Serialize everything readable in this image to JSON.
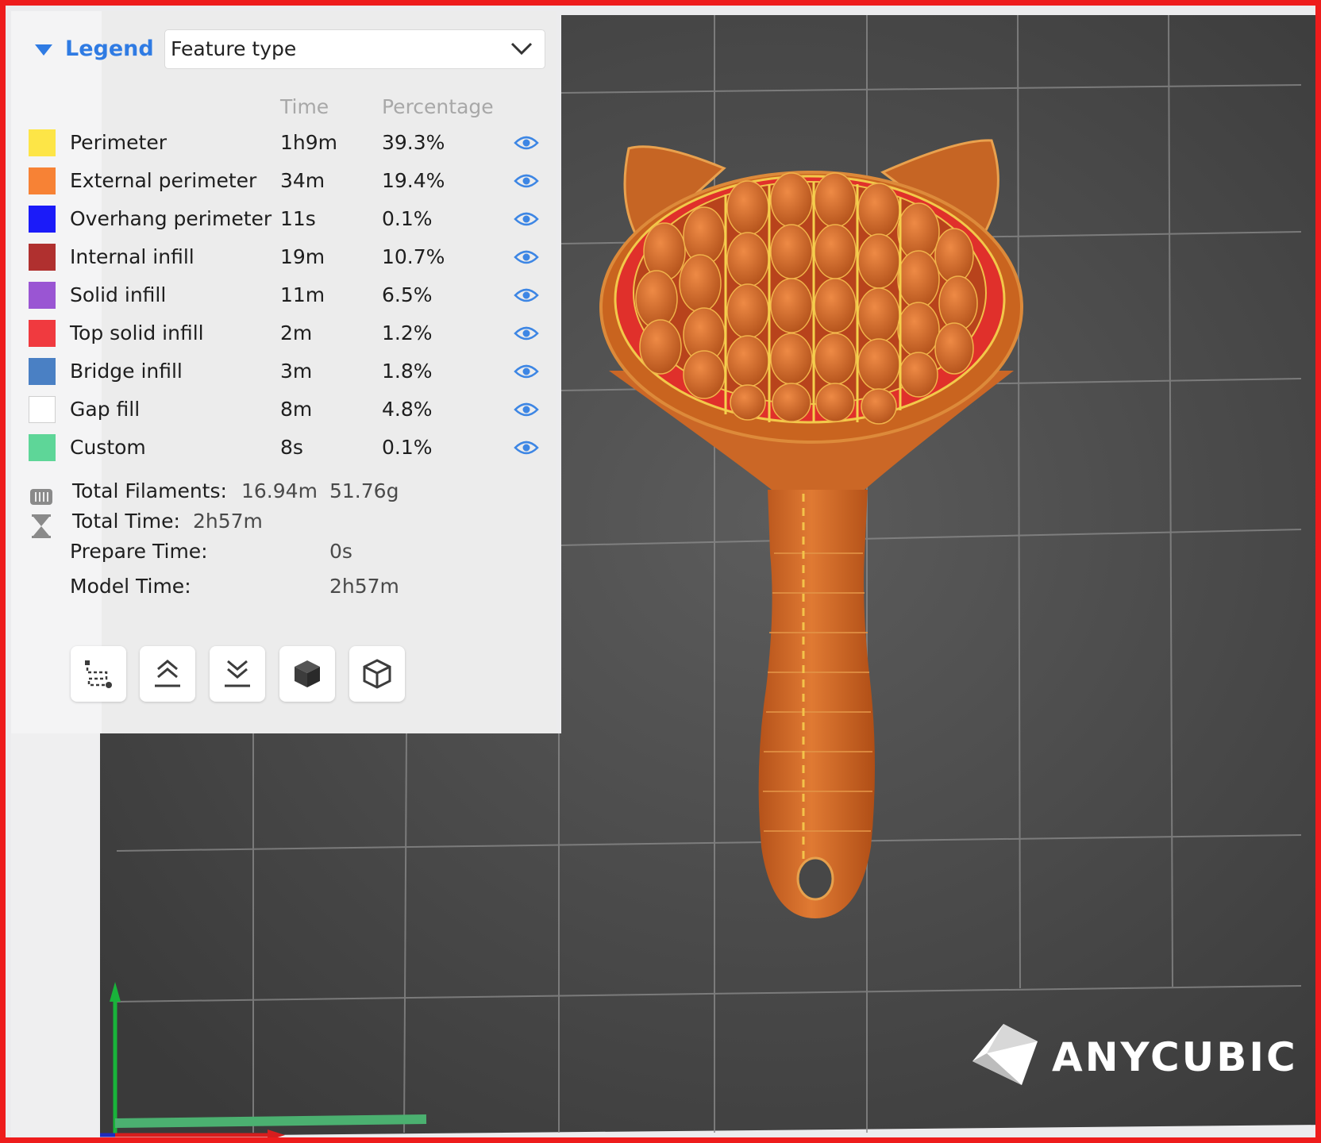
{
  "legend": {
    "title": "Legend",
    "view_type": "Feature type",
    "col_time": "Time",
    "col_percentage": "Percentage",
    "rows": [
      {
        "name": "Perimeter",
        "time": "1h9m",
        "percentage": "39.3%",
        "color": "#fde547"
      },
      {
        "name": "External perimeter",
        "time": "34m",
        "percentage": "19.4%",
        "color": "#f78235"
      },
      {
        "name": "Overhang perimeter",
        "time": "11s",
        "percentage": "0.1%",
        "color": "#1b1bf9"
      },
      {
        "name": "Internal infill",
        "time": "19m",
        "percentage": "10.7%",
        "color": "#b0302f"
      },
      {
        "name": "Solid infill",
        "time": "11m",
        "percentage": "6.5%",
        "color": "#9a55d3"
      },
      {
        "name": "Top solid infill",
        "time": "2m",
        "percentage": "1.2%",
        "color": "#f03a3f"
      },
      {
        "name": "Bridge infill",
        "time": "3m",
        "percentage": "1.8%",
        "color": "#4a80c4"
      },
      {
        "name": "Gap fill",
        "time": "8m",
        "percentage": "4.8%",
        "color": "#ffffff"
      },
      {
        "name": "Custom",
        "time": "8s",
        "percentage": "0.1%",
        "color": "#5ed698"
      }
    ],
    "eye_icon": "eye-icon",
    "eye_color": "#3d86e4"
  },
  "summary": {
    "filaments_label": "Total Filaments:",
    "filaments_length": "16.94m",
    "filaments_weight": "51.76g",
    "total_time_label": "Total Time:",
    "total_time_value": "2h57m",
    "prepare_label": "Prepare Time:",
    "prepare_value": "0s",
    "model_label": "Model Time:",
    "model_value": "2h57m"
  },
  "toolbar": [
    {
      "name": "travel-path-tool",
      "icon": "travel-path-icon"
    },
    {
      "name": "top-layer-tool",
      "icon": "collapse-up-icon"
    },
    {
      "name": "bottom-layer-tool",
      "icon": "collapse-down-icon"
    },
    {
      "name": "solid-view-tool",
      "icon": "solid-cube-icon"
    },
    {
      "name": "wireframe-view-tool",
      "icon": "wire-cube-icon"
    }
  ],
  "brand": {
    "name": "ANYCUBIC"
  },
  "colors": {
    "frame": "#ee1c1c",
    "accent": "#2f7be3",
    "model": "#d26a24",
    "bed": "#474747"
  }
}
